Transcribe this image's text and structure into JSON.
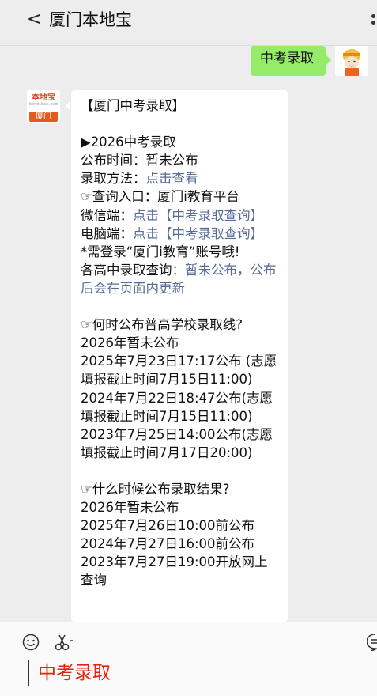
{
  "header": {
    "back_glyph": "<",
    "title": "厦门本地宝"
  },
  "user_message": {
    "text": "中考录取"
  },
  "bot": {
    "avatar_top": "本地宝",
    "avatar_sub": "bendibao.com",
    "avatar_city": "厦门",
    "lines": {
      "l1": "【厦门中考录取】",
      "l2": "▶2026中考录取",
      "l3": "公布时间：暂未公布",
      "l4_label": "录取方法：",
      "l4_link": "点击查看",
      "l5": "☞查询入口：厦门i教育平台",
      "l6_label": "微信端：",
      "l6_link": "点击【中考录取查询】",
      "l7_label": "电脑端：",
      "l7_link": "点击【中考录取查询】",
      "l8": "*需登录“厦门i教育”账号哦!",
      "l9_label": "各高中录取查询：",
      "l9_link": "暂未公布，公布后会在页面内更新",
      "l10": "☞何时公布普高学校录取线?",
      "l11": "2026年暂未公布",
      "l12": "2025年7月23日17:17公布 (志愿填报截止时间7月15日11:00)",
      "l13": "2024年7月22日18:47公布(志愿填报截止时间7月15日11:00)",
      "l14": "2023年7月25日14:00公布(志愿填报截止时间7月17日20:00)",
      "l15": "☞什么时候公布录取结果?",
      "l16": "2026年暂未公布",
      "l17": "2025年7月26日10:00前公布",
      "l18": "2024年7月27日16:00前公布",
      "l19": "2023年7月27日19:00开放网上查询"
    }
  },
  "input": {
    "text": "中考录取"
  },
  "colors": {
    "user_bubble": "#95ec69",
    "link": "#576b95",
    "input_text": "#e5230f"
  }
}
